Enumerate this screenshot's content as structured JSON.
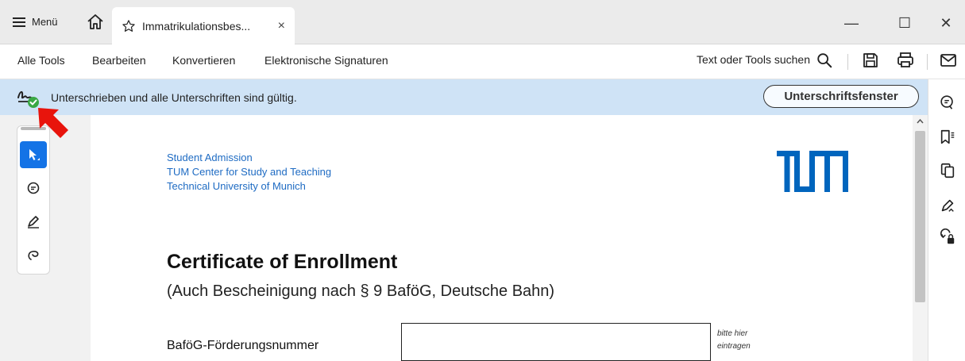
{
  "titlebar": {
    "menu_label": "Menü",
    "tab_title": "Immatrikulationsbes...",
    "tab_close": "×",
    "minimize": "—",
    "maximize": "☐",
    "close": "✕"
  },
  "menubar": {
    "items": [
      "Alle Tools",
      "Bearbeiten",
      "Konvertieren",
      "Elektronische Signaturen"
    ],
    "search_label": "Text oder Tools suchen"
  },
  "signature_banner": {
    "text": "Unterschrieben und alle Unterschriften sind gültig.",
    "button_label": "Unterschriftsfenster",
    "status_color": "#3aa845"
  },
  "document": {
    "address_lines": [
      "Student Admission",
      "TUM Center for Study and Teaching",
      "Technical University of Munich"
    ],
    "logo_color": "#0065bd",
    "title": "Certificate of Enrollment",
    "subtitle": "(Auch Bescheinigung nach § 9 BaföG, Deutsche Bahn)",
    "field_label": "BaföG-Förderungsnummer",
    "field_value": "",
    "hint_lines": [
      "bitte hier",
      "eintragen"
    ]
  },
  "tools": [
    "select-tool",
    "comment-tool",
    "draw-tool",
    "lasso-tool"
  ],
  "accent_color": "#1473e6",
  "annotation_arrow_color": "#e8140c"
}
